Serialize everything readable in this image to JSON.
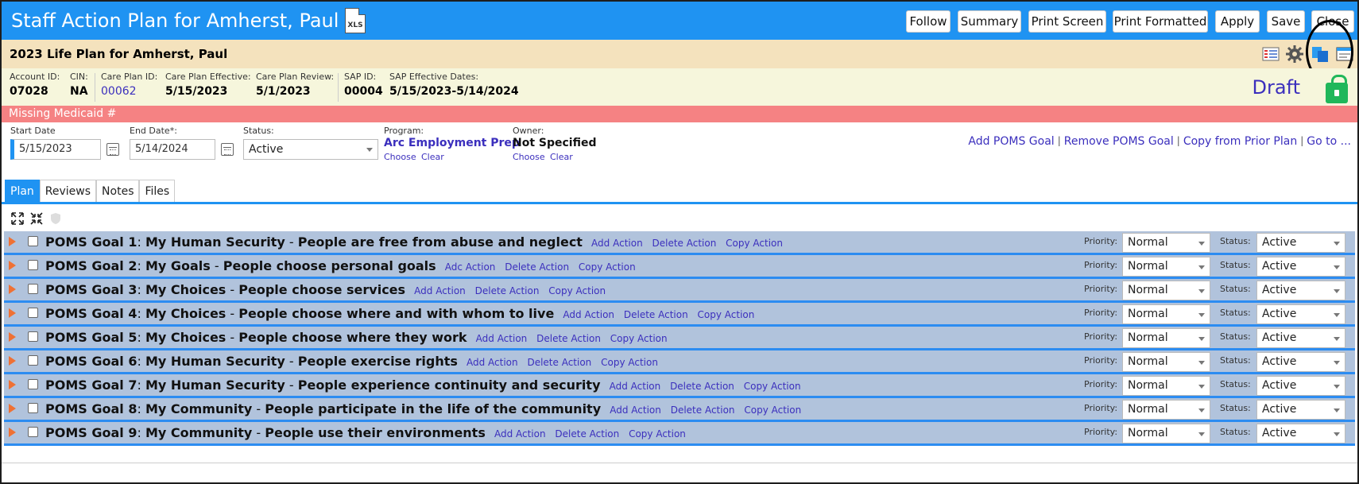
{
  "app": {
    "title": "Staff Action Plan for Amherst, Paul",
    "xls_icon": "XLS"
  },
  "toolbar": {
    "buttons": [
      "Follow",
      "Summary",
      "Print Screen",
      "Print Formatted",
      "Apply",
      "Save",
      "Close"
    ]
  },
  "lifeplan": {
    "title": "2023 Life Plan for Amherst, Paul",
    "icons": [
      "grid-icon",
      "gear-icon",
      "copy-icon",
      "card-icon"
    ]
  },
  "info": {
    "account_id_label": "Account ID:",
    "account_id": "07028",
    "cin_label": "CIN:",
    "cin": "NA",
    "care_plan_id_label": "Care Plan ID:",
    "care_plan_id": "00062",
    "care_plan_effective_label": "Care Plan Effective:",
    "care_plan_effective": "5/15/2023",
    "care_plan_review_label": "Care Plan Review:",
    "care_plan_review": "5/1/2023",
    "sap_id_label": "SAP ID:",
    "sap_id": "00004",
    "sap_dates_label": "SAP Effective Dates:",
    "sap_dates": "5/15/2023-5/14/2024",
    "status": "Draft"
  },
  "warning": "Missing Medicaid #",
  "filters": {
    "start_label": "Start Date",
    "start_value": "5/15/2023",
    "end_label": "End Date*:",
    "end_value": "5/14/2024",
    "status_label": "Status:",
    "status_value": "Active",
    "program_label": "Program:",
    "program_value": "Arc Employment Prep",
    "owner_label": "Owner:",
    "owner_value": "Not Specified",
    "choose": "Choose",
    "clear": "Clear",
    "links": [
      "Add POMS Goal",
      "Remove POMS Goal",
      "Copy from Prior Plan",
      "Go to ..."
    ]
  },
  "tabs": [
    "Plan",
    "Reviews",
    "Notes",
    "Files"
  ],
  "goal_labels": {
    "add": "Add Action",
    "delete": "Delete Action",
    "copy": "Copy Action",
    "priority": "Priority:",
    "status": "Status:"
  },
  "goals": [
    {
      "num": "POMS Goal 1",
      "cat": "My Human Security",
      "text": "People are free from abuse and neglect",
      "add": "Add Action",
      "priority": "Normal",
      "status": "Active"
    },
    {
      "num": "POMS Goal 2",
      "cat": "My Goals",
      "text": "People choose personal goals",
      "add": "Adc Action",
      "priority": "Normal",
      "status": "Active"
    },
    {
      "num": "POMS Goal 3",
      "cat": "My Choices",
      "text": "People choose services",
      "add": "Add Action",
      "priority": "Normal",
      "status": "Active"
    },
    {
      "num": "POMS Goal 4",
      "cat": "My Choices",
      "text": "People choose where and with whom to live",
      "add": "Add Action",
      "priority": "Normal",
      "status": "Active"
    },
    {
      "num": "POMS Goal 5",
      "cat": "My Choices",
      "text": "People choose where they work",
      "add": "Add Action",
      "priority": "Normal",
      "status": "Active"
    },
    {
      "num": "POMS Goal 6",
      "cat": "My Human Security",
      "text": "People exercise rights",
      "add": "Add Action",
      "priority": "Normal",
      "status": "Active"
    },
    {
      "num": "POMS Goal 7",
      "cat": "My Human Security",
      "text": "People experience continuity and security",
      "add": "Add Action",
      "priority": "Normal",
      "status": "Active"
    },
    {
      "num": "POMS Goal 8",
      "cat": "My Community",
      "text": "People participate in the life of the community",
      "add": "Add Action",
      "priority": "Normal",
      "status": "Active"
    },
    {
      "num": "POMS Goal 9",
      "cat": "My Community",
      "text": "People use their environments",
      "add": "Add Action",
      "priority": "Normal",
      "status": "Active"
    }
  ],
  "colors": {
    "titlebar": "#1f93f2",
    "lifeplan_bg": "#f4e2bd",
    "info_bg": "#f6f6dc",
    "warning_bg": "#f58283",
    "goal_bg": "#b1c3dc",
    "link": "#3b2fbd",
    "lock": "#20b75a"
  }
}
